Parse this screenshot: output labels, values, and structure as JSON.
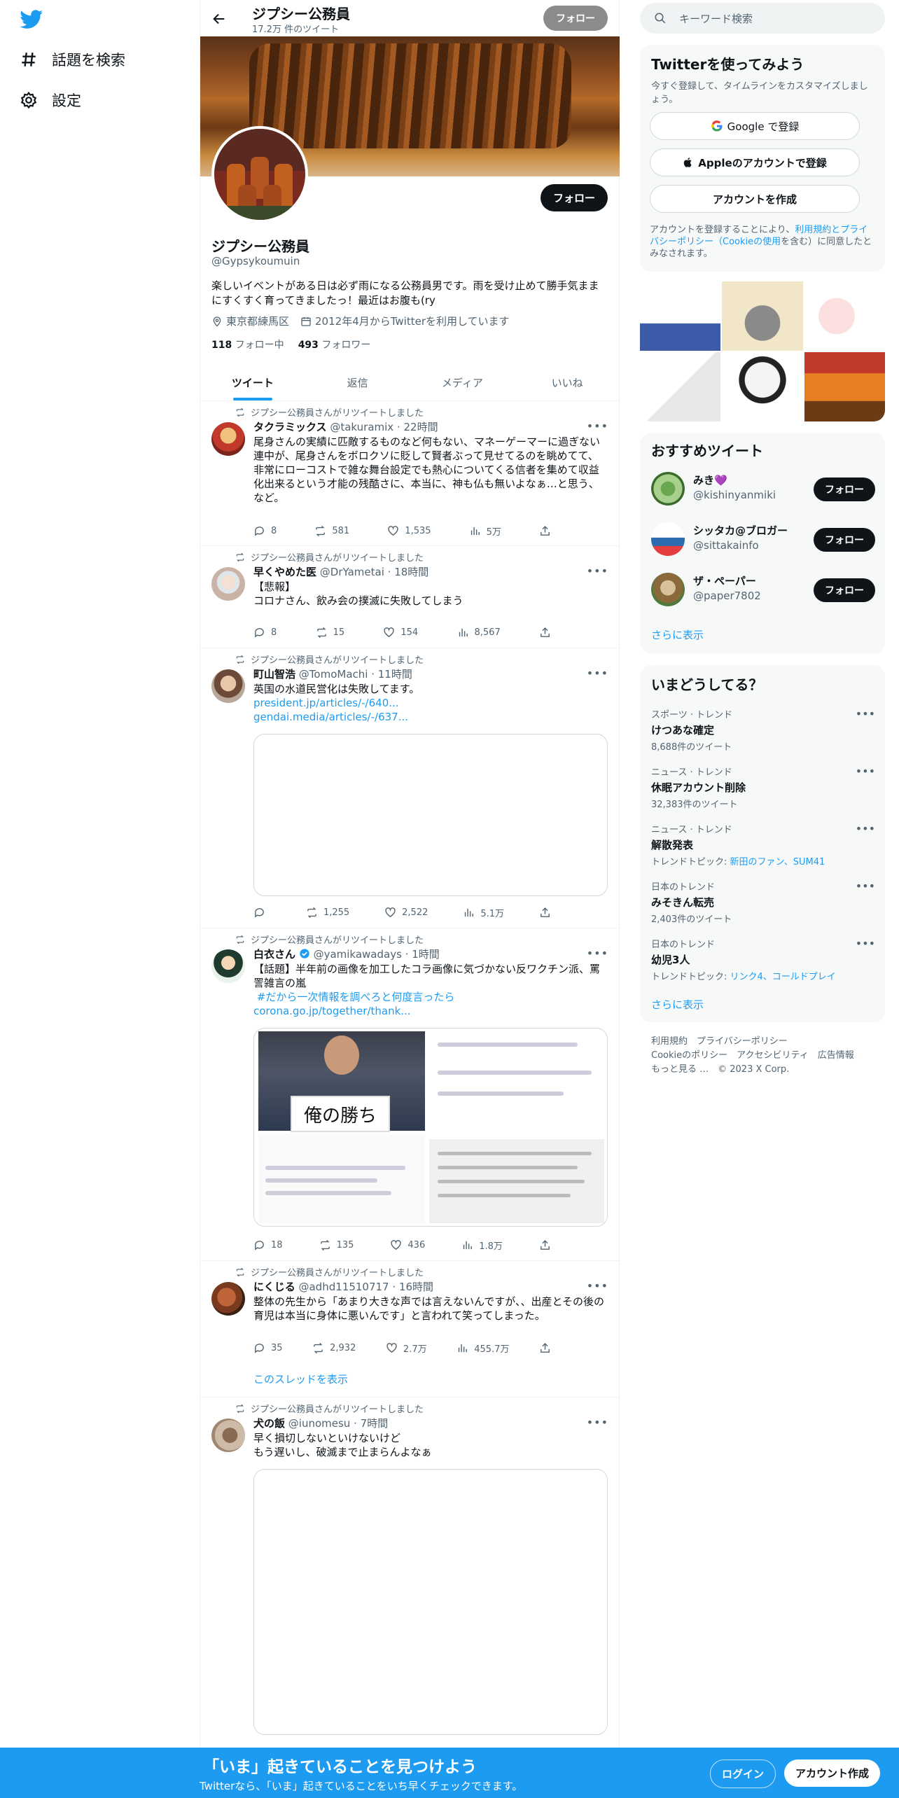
{
  "nav": {
    "explore_label": "話題を検索",
    "settings_label": "設定"
  },
  "header": {
    "title": "ジプシー公務員",
    "tweet_count": "17.2万 件のツイート",
    "follow_label": "フォロー"
  },
  "profile": {
    "name": "ジプシー公務員",
    "handle": "@Gypsykoumuin",
    "bio": "楽しいイベントがある日は必ず雨になる公務員男です。雨を受け止めて勝手気ままにすくすく育ってきましたっ！最近はお腹も(ry",
    "location": "東京都練馬区",
    "joined": "2012年4月からTwitterを利用しています",
    "following_count": "118",
    "following_label": "フォロー中",
    "followers_count": "493",
    "followers_label": "フォロワー",
    "follow_label": "フォロー"
  },
  "tabs": [
    "ツイート",
    "返信",
    "メディア",
    "いいね"
  ],
  "retweet_label": "ジプシー公務員さんがリツイートしました",
  "tweets": [
    {
      "name": "タクラミックス",
      "handle": "@takuramix",
      "time": "· 22時間",
      "text": "尾身さんの実績に匹敵するものなど何もない、マネーゲーマーに過ぎない連中が、尾身さんをボロクソに貶して賢者ぶって見せてるのを眺めてて、非常にローコストで雑な舞台設定でも熱心についてくる信者を集めて収益化出来るという才能の残酷さに、本当に、神も仏も無いよなぁ…と思う、など。",
      "replies": "8",
      "retweets": "581",
      "likes": "1,535",
      "views": "5万"
    },
    {
      "name": "早くやめた医",
      "handle": "@DrYametai",
      "time": "· 18時間",
      "text": "【悲報】\nコロナさん、飲み会の撲滅に失敗してしまう",
      "replies": "8",
      "retweets": "15",
      "likes": "154",
      "views": "8,567"
    },
    {
      "name": "町山智浩",
      "handle": "@TomoMachi",
      "time": "· 11時間",
      "text": "英国の水道民営化は失敗してます。",
      "link1": "president.jp/articles/-/640...",
      "link2": "gendai.media/articles/-/637...",
      "replies": "",
      "retweets": "1,255",
      "likes": "2,522",
      "views": "5.1万"
    },
    {
      "name": "白衣さん",
      "handle": "@yamikawadays",
      "time": "· 1時間",
      "text": "【話題】半年前の画像を加工したコラ画像に気づかない反ワクチン派、罵詈雑言の嵐",
      "hashtag": " #だから一次情報を調べろと何度言ったら",
      "link1": "corona.go.jp/together/thank...",
      "sign_text": "俺の勝ち",
      "replies": "18",
      "retweets": "135",
      "likes": "436",
      "views": "1.8万"
    },
    {
      "name": "にくじる",
      "handle": "@adhd11510717",
      "time": "· 16時間",
      "text": "整体の先生から「あまり大きな声では言えないんですが、、出産とその後の育児は本当に身体に悪いんです」と言われて笑ってしまった。",
      "replies": "35",
      "retweets": "2,932",
      "likes": "2.7万",
      "views": "455.7万",
      "thread_label": "このスレッドを表示"
    },
    {
      "name": "犬の飯",
      "handle": "@iunomesu",
      "time": "· 7時間",
      "text": "早く損切しないといけないけど\nもう遅いし、破滅まで止まらんよなぁ"
    }
  ],
  "search": {
    "placeholder": "キーワード検索"
  },
  "signup": {
    "title": "Twitterを使ってみよう",
    "subtitle": "今すぐ登録して、タイムラインをカスタマイズしましょう。",
    "google": "Google で登録",
    "apple": "Appleのアカウントで登録",
    "create": "アカウントを作成",
    "terms_pre": "アカウントを登録することにより、",
    "terms_link": "利用規約とプライバシーポリシー（Cookieの使用",
    "terms_post": "を含む）に同意したとみなされます。"
  },
  "recommend": {
    "title": "おすすめツイート",
    "more": "さらに表示",
    "follow_label": "フォロー",
    "users": [
      {
        "name": "みき💜",
        "handle": "@kishinyanmiki"
      },
      {
        "name": "シッタカ@ブロガー",
        "handle": "@sittakainfo"
      },
      {
        "name": "ザ・ペーパー",
        "handle": "@paper7802"
      }
    ]
  },
  "trends": {
    "title": "いまどうしてる？",
    "more": "さらに表示",
    "items": [
      {
        "cat": "スポーツ · トレンド",
        "name": "けつあな確定",
        "count": "8,688件のツイート"
      },
      {
        "cat": "ニュース · トレンド",
        "name": "休眠アカウント削除",
        "count": "32,383件のツイート"
      },
      {
        "cat": "ニュース · トレンド",
        "name": "解散発表",
        "count": "トレンドトピック: ",
        "topics": "新田のファン、SUM41"
      },
      {
        "cat": "日本のトレンド",
        "name": "みそきん転売",
        "count": "2,403件のツイート"
      },
      {
        "cat": "日本のトレンド",
        "name": "幼児3人",
        "count": "トレンドトピック: ",
        "topics": "リンク4、コールドプレイ"
      }
    ]
  },
  "footer": {
    "line1": "利用規約　プライバシーポリシー",
    "line2": "Cookieのポリシー　アクセシビリティ　広告情報",
    "line3": "もっと見る …　© 2023 X Corp."
  },
  "bottombar": {
    "title": "「いま」起きていることを見つけよう",
    "subtitle": "Twitterなら、「いま」起きていることをいち早くチェックできます。",
    "login": "ログイン",
    "signup": "アカウント作成"
  },
  "colors": {
    "accent": "#1d9bf0",
    "text": "#0f1419",
    "muted": "#536471"
  }
}
